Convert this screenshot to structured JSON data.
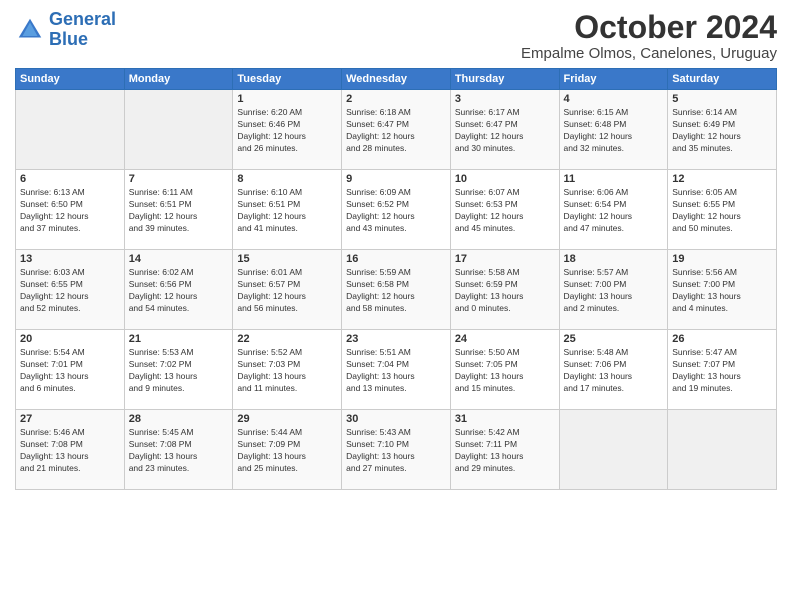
{
  "header": {
    "logo_line1": "General",
    "logo_line2": "Blue",
    "month": "October 2024",
    "location": "Empalme Olmos, Canelones, Uruguay"
  },
  "weekdays": [
    "Sunday",
    "Monday",
    "Tuesday",
    "Wednesday",
    "Thursday",
    "Friday",
    "Saturday"
  ],
  "weeks": [
    [
      {
        "day": "",
        "info": ""
      },
      {
        "day": "",
        "info": ""
      },
      {
        "day": "1",
        "info": "Sunrise: 6:20 AM\nSunset: 6:46 PM\nDaylight: 12 hours\nand 26 minutes."
      },
      {
        "day": "2",
        "info": "Sunrise: 6:18 AM\nSunset: 6:47 PM\nDaylight: 12 hours\nand 28 minutes."
      },
      {
        "day": "3",
        "info": "Sunrise: 6:17 AM\nSunset: 6:47 PM\nDaylight: 12 hours\nand 30 minutes."
      },
      {
        "day": "4",
        "info": "Sunrise: 6:15 AM\nSunset: 6:48 PM\nDaylight: 12 hours\nand 32 minutes."
      },
      {
        "day": "5",
        "info": "Sunrise: 6:14 AM\nSunset: 6:49 PM\nDaylight: 12 hours\nand 35 minutes."
      }
    ],
    [
      {
        "day": "6",
        "info": "Sunrise: 6:13 AM\nSunset: 6:50 PM\nDaylight: 12 hours\nand 37 minutes."
      },
      {
        "day": "7",
        "info": "Sunrise: 6:11 AM\nSunset: 6:51 PM\nDaylight: 12 hours\nand 39 minutes."
      },
      {
        "day": "8",
        "info": "Sunrise: 6:10 AM\nSunset: 6:51 PM\nDaylight: 12 hours\nand 41 minutes."
      },
      {
        "day": "9",
        "info": "Sunrise: 6:09 AM\nSunset: 6:52 PM\nDaylight: 12 hours\nand 43 minutes."
      },
      {
        "day": "10",
        "info": "Sunrise: 6:07 AM\nSunset: 6:53 PM\nDaylight: 12 hours\nand 45 minutes."
      },
      {
        "day": "11",
        "info": "Sunrise: 6:06 AM\nSunset: 6:54 PM\nDaylight: 12 hours\nand 47 minutes."
      },
      {
        "day": "12",
        "info": "Sunrise: 6:05 AM\nSunset: 6:55 PM\nDaylight: 12 hours\nand 50 minutes."
      }
    ],
    [
      {
        "day": "13",
        "info": "Sunrise: 6:03 AM\nSunset: 6:55 PM\nDaylight: 12 hours\nand 52 minutes."
      },
      {
        "day": "14",
        "info": "Sunrise: 6:02 AM\nSunset: 6:56 PM\nDaylight: 12 hours\nand 54 minutes."
      },
      {
        "day": "15",
        "info": "Sunrise: 6:01 AM\nSunset: 6:57 PM\nDaylight: 12 hours\nand 56 minutes."
      },
      {
        "day": "16",
        "info": "Sunrise: 5:59 AM\nSunset: 6:58 PM\nDaylight: 12 hours\nand 58 minutes."
      },
      {
        "day": "17",
        "info": "Sunrise: 5:58 AM\nSunset: 6:59 PM\nDaylight: 13 hours\nand 0 minutes."
      },
      {
        "day": "18",
        "info": "Sunrise: 5:57 AM\nSunset: 7:00 PM\nDaylight: 13 hours\nand 2 minutes."
      },
      {
        "day": "19",
        "info": "Sunrise: 5:56 AM\nSunset: 7:00 PM\nDaylight: 13 hours\nand 4 minutes."
      }
    ],
    [
      {
        "day": "20",
        "info": "Sunrise: 5:54 AM\nSunset: 7:01 PM\nDaylight: 13 hours\nand 6 minutes."
      },
      {
        "day": "21",
        "info": "Sunrise: 5:53 AM\nSunset: 7:02 PM\nDaylight: 13 hours\nand 9 minutes."
      },
      {
        "day": "22",
        "info": "Sunrise: 5:52 AM\nSunset: 7:03 PM\nDaylight: 13 hours\nand 11 minutes."
      },
      {
        "day": "23",
        "info": "Sunrise: 5:51 AM\nSunset: 7:04 PM\nDaylight: 13 hours\nand 13 minutes."
      },
      {
        "day": "24",
        "info": "Sunrise: 5:50 AM\nSunset: 7:05 PM\nDaylight: 13 hours\nand 15 minutes."
      },
      {
        "day": "25",
        "info": "Sunrise: 5:48 AM\nSunset: 7:06 PM\nDaylight: 13 hours\nand 17 minutes."
      },
      {
        "day": "26",
        "info": "Sunrise: 5:47 AM\nSunset: 7:07 PM\nDaylight: 13 hours\nand 19 minutes."
      }
    ],
    [
      {
        "day": "27",
        "info": "Sunrise: 5:46 AM\nSunset: 7:08 PM\nDaylight: 13 hours\nand 21 minutes."
      },
      {
        "day": "28",
        "info": "Sunrise: 5:45 AM\nSunset: 7:08 PM\nDaylight: 13 hours\nand 23 minutes."
      },
      {
        "day": "29",
        "info": "Sunrise: 5:44 AM\nSunset: 7:09 PM\nDaylight: 13 hours\nand 25 minutes."
      },
      {
        "day": "30",
        "info": "Sunrise: 5:43 AM\nSunset: 7:10 PM\nDaylight: 13 hours\nand 27 minutes."
      },
      {
        "day": "31",
        "info": "Sunrise: 5:42 AM\nSunset: 7:11 PM\nDaylight: 13 hours\nand 29 minutes."
      },
      {
        "day": "",
        "info": ""
      },
      {
        "day": "",
        "info": ""
      }
    ]
  ]
}
